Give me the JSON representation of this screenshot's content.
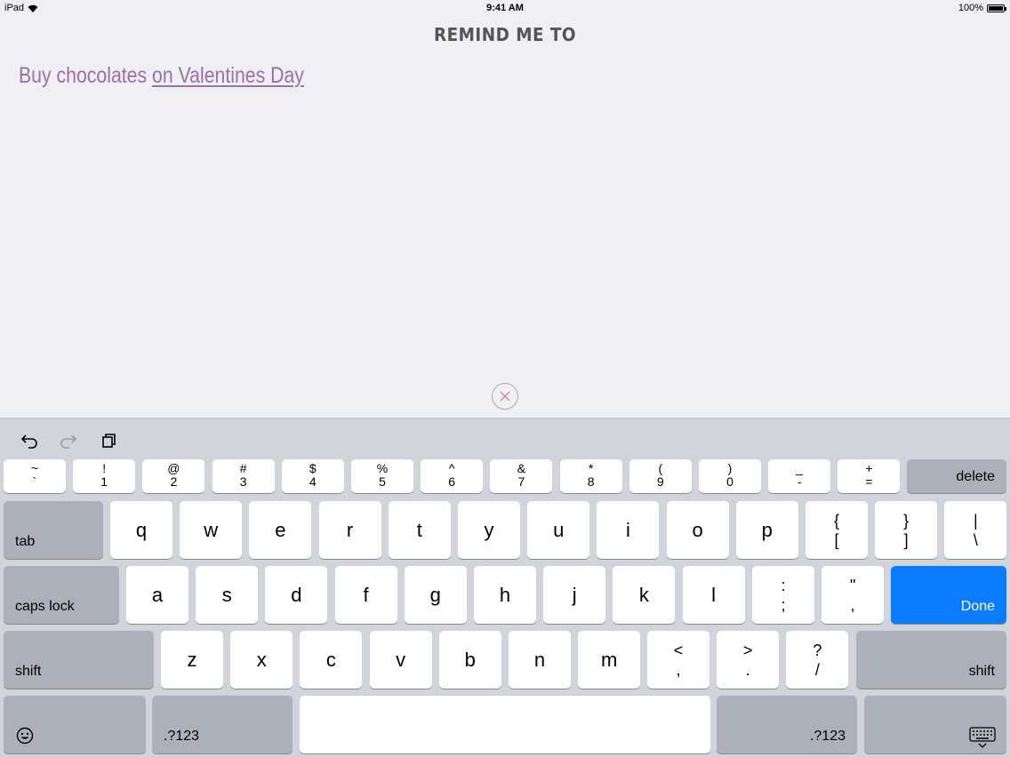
{
  "status_bar": {
    "device": "iPad",
    "time": "9:41 AM",
    "battery": "100%"
  },
  "header": {
    "title": "REMIND ME TO"
  },
  "reminder": {
    "text": "Buy chocolates ",
    "date_phrase": "on Valentines Day"
  },
  "keyboard": {
    "number_row": [
      {
        "top": "~",
        "bottom": "`"
      },
      {
        "top": "!",
        "bottom": "1"
      },
      {
        "top": "@",
        "bottom": "2"
      },
      {
        "top": "#",
        "bottom": "3"
      },
      {
        "top": "$",
        "bottom": "4"
      },
      {
        "top": "%",
        "bottom": "5"
      },
      {
        "top": "^",
        "bottom": "6"
      },
      {
        "top": "&",
        "bottom": "7"
      },
      {
        "top": "*",
        "bottom": "8"
      },
      {
        "top": "(",
        "bottom": "9"
      },
      {
        "top": ")",
        "bottom": "0"
      },
      {
        "top": "_",
        "bottom": "-"
      },
      {
        "top": "+",
        "bottom": "="
      }
    ],
    "delete_label": "delete",
    "tab_label": "tab",
    "row1": [
      "q",
      "w",
      "e",
      "r",
      "t",
      "y",
      "u",
      "i",
      "o",
      "p"
    ],
    "row1_symbols": [
      {
        "top": "{",
        "bottom": "["
      },
      {
        "top": "}",
        "bottom": "]"
      },
      {
        "top": "|",
        "bottom": "\\"
      }
    ],
    "caps_label": "caps lock",
    "row2": [
      "a",
      "s",
      "d",
      "f",
      "g",
      "h",
      "j",
      "k",
      "l"
    ],
    "row2_symbols": [
      {
        "top": ":",
        "bottom": ";"
      },
      {
        "top": "\"",
        "bottom": ","
      }
    ],
    "done_label": "Done",
    "shift_label": "shift",
    "row3": [
      "z",
      "x",
      "c",
      "v",
      "b",
      "n",
      "m"
    ],
    "row3_symbols": [
      {
        "top": "<",
        "bottom": ","
      },
      {
        "top": ">",
        "bottom": "."
      },
      {
        "top": "?",
        "bottom": "/"
      }
    ],
    "numbers_label": ".?123",
    "space_label": "",
    "accent_color": "#0a7cff"
  }
}
